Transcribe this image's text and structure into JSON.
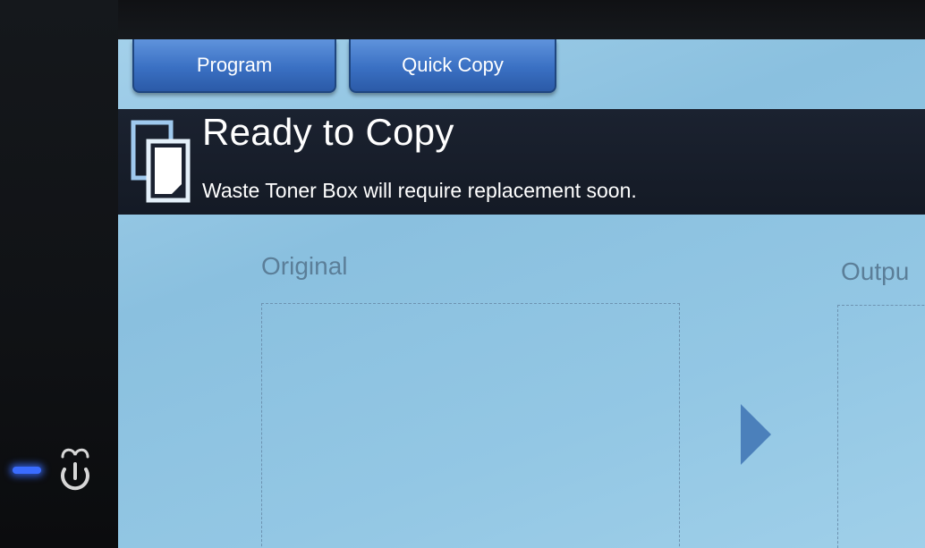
{
  "tabs": [
    {
      "label": "Program"
    },
    {
      "label": "Quick Copy"
    }
  ],
  "status": {
    "title": "Ready to Copy",
    "message": "Waste Toner Box will require replacement soon.",
    "icon": "copy-icon"
  },
  "preview": {
    "original_label": "Original",
    "output_label": "Outpu"
  },
  "device": {
    "power_icon": "power-icon",
    "led_color": "#3a6cff"
  },
  "colors": {
    "screen_bg": "#93c7e4",
    "tab_blue": "#3a70c3",
    "status_bar": "#161c27"
  }
}
